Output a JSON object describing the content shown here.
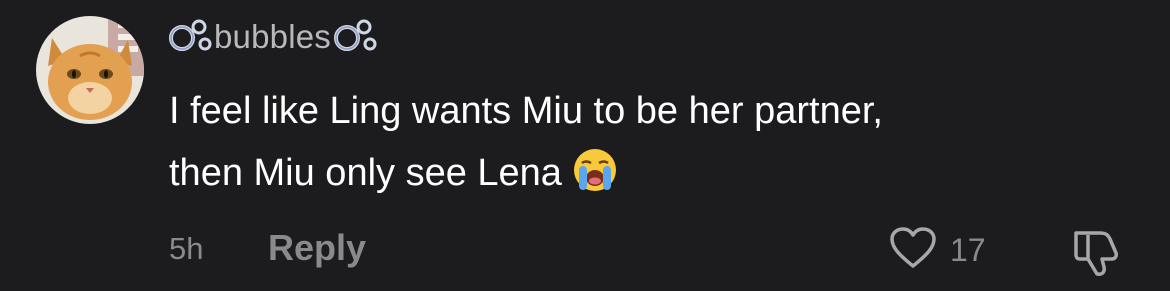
{
  "comment": {
    "username": "bubbles",
    "avatar_icon": "orange-cat-avatar",
    "decoration_icon": "bubbles-emoji",
    "text_line_1": "I feel like Ling wants Miu to be her partner,",
    "text_line_2": "then Miu only see Lena",
    "text_emoji": "loudly-crying-face-emoji",
    "time": "5h",
    "reply_label": "Reply",
    "like_count": "17",
    "like_icon": "heart-icon",
    "dislike_icon": "thumbs-down-icon"
  },
  "colors": {
    "background": "#1c1c1e",
    "text": "#ffffff",
    "muted": "#8a8a8e",
    "username": "#b9b9bd"
  }
}
